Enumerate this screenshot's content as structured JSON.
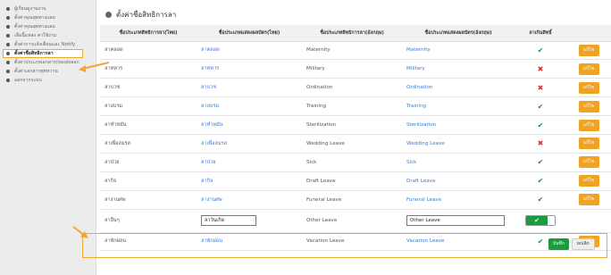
{
  "sidebar": {
    "items": [
      {
        "label": "ผู้เรียนดูงานงาน"
      },
      {
        "label": "ตั้งค่าคุณสุดทางแลม"
      },
      {
        "label": "ตั้งค่าคุณสุดทางแลม"
      },
      {
        "label": "เลือนี้แหล่ง ค่าใช้งาน"
      },
      {
        "label": "ตั้งค่าการแจ้งเตือนและ Notify"
      },
      {
        "label": "ตั้งค่าชื่อสิทธิการลา"
      },
      {
        "label": "ตั้งค่าประเภทเอกสาร/ของส่งออก"
      },
      {
        "label": "ตั้งค่าเอกสารทุทหวาน"
      },
      {
        "label": "ออกจากระบบ"
      }
    ]
  },
  "page": {
    "title": "ตั้งค่าชื่อสิทธิการลา"
  },
  "table": {
    "headers": [
      "ชื่อประเภทสิทธิการลา(ไทย)",
      "ชื่อประเภทแสดงผลบัตร(ไทย)",
      "ชื่อประเภทสิทธิการลา(อังกฤษ)",
      "ชื่อประเภทแสดงผลบัตร(อังกฤษ)",
      "ลาเกินสิทธิ์",
      ""
    ],
    "rows": [
      {
        "th": "ลาคลอด",
        "th_display": "ลาคลอด",
        "en": "Maternity",
        "en_display": "Maternity",
        "allowed": true,
        "action": "แก้ไข"
      },
      {
        "th": "ลาทหาร",
        "th_display": "ลาทหาร",
        "en": "Military",
        "en_display": "Military",
        "allowed": false,
        "action": "แก้ไข"
      },
      {
        "th": "ลาบวช",
        "th_display": "ลาบวช",
        "en": "Ordination",
        "en_display": "Ordination",
        "allowed": false,
        "action": "แก้ไข"
      },
      {
        "th": "ลาอบรม",
        "th_display": "ลาอบรม",
        "en": "Training",
        "en_display": "Training",
        "allowed": true,
        "action": "แก้ไข"
      },
      {
        "th": "ลาทำหมัน",
        "th_display": "ลาทำหมัน",
        "en": "Sterilization",
        "en_display": "Sterilization",
        "allowed": true,
        "action": "แก้ไข"
      },
      {
        "th": "ลาเพื่อสมรส",
        "th_display": "ลาเพื่อสมรส",
        "en": "Wedding Leave",
        "en_display": "Wedding Leave",
        "allowed": false,
        "action": "แก้ไข"
      },
      {
        "th": "ลาป่วย",
        "th_display": "ลาป่วย",
        "en": "Sick",
        "en_display": "Sick",
        "allowed": true,
        "action": "แก้ไข"
      },
      {
        "th": "ลากิจ",
        "th_display": "ลากิจ",
        "en": "Draft Leave",
        "en_display": "Draft Leave",
        "allowed": true,
        "action": "แก้ไข"
      },
      {
        "th": "ลางานศพ",
        "th_display": "ลางานศพ",
        "en": "Funeral Leave",
        "en_display": "Funeral Leave",
        "allowed": true,
        "action": "แก้ไข"
      }
    ],
    "edit_row": {
      "th": "ลาอื่นๆ",
      "th_display_value": "ลาวันเกิด",
      "en": "Other Leave",
      "en_display_value": "Other Leave",
      "save": "บันทึก",
      "cancel": "ยกเลิก"
    },
    "last_row": {
      "th": "ลาพักผ่อน",
      "th_display": "ลาพักผ่อน",
      "en": "Vacation Leave",
      "en_display": "Vacation Leave",
      "allowed": true,
      "action": "แก้ไข"
    }
  }
}
